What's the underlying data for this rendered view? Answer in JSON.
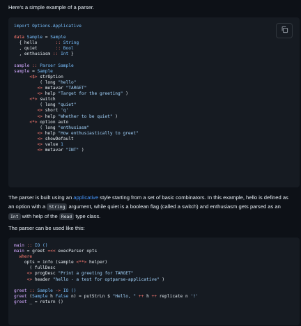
{
  "intro": {
    "text": "Here's a simple example of a parser."
  },
  "code1": {
    "copy_icon": "copy-icon",
    "lines": [
      [
        {
          "t": "import Options.Applicative",
          "c": "ty"
        }
      ],
      [
        {
          "t": "",
          "c": ""
        }
      ],
      [
        {
          "t": "data ",
          "c": "kw"
        },
        {
          "t": "Sample",
          "c": "ty"
        },
        {
          "t": " = ",
          "c": ""
        },
        {
          "t": "Sample",
          "c": "ty"
        }
      ],
      [
        {
          "t": "  { hello       ",
          "c": ""
        },
        {
          "t": ":: ",
          "c": "op"
        },
        {
          "t": "String",
          "c": "ty"
        }
      ],
      [
        {
          "t": "  , quiet       ",
          "c": ""
        },
        {
          "t": ":: ",
          "c": "op"
        },
        {
          "t": "Bool",
          "c": "ty"
        }
      ],
      [
        {
          "t": "  , enthusiasm ",
          "c": ""
        },
        {
          "t": ":: ",
          "c": "op"
        },
        {
          "t": "Int",
          "c": "ty"
        },
        {
          "t": " }",
          "c": ""
        }
      ],
      [
        {
          "t": "",
          "c": ""
        }
      ],
      [
        {
          "t": "sample",
          "c": "fn"
        },
        {
          "t": " :: ",
          "c": "op"
        },
        {
          "t": "Parser Sample",
          "c": "ty"
        }
      ],
      [
        {
          "t": "sample",
          "c": "fn"
        },
        {
          "t": " = ",
          "c": ""
        },
        {
          "t": "Sample",
          "c": "ty"
        }
      ],
      [
        {
          "t": "      ",
          "c": ""
        },
        {
          "t": "<$>",
          "c": "op"
        },
        {
          "t": " strOption",
          "c": ""
        }
      ],
      [
        {
          "t": "          ( long ",
          "c": ""
        },
        {
          "t": "\"hello\"",
          "c": "str"
        }
      ],
      [
        {
          "t": "         ",
          "c": ""
        },
        {
          "t": "<>",
          "c": "op"
        },
        {
          "t": " metavar ",
          "c": ""
        },
        {
          "t": "\"TARGET\"",
          "c": "str"
        }
      ],
      [
        {
          "t": "         ",
          "c": ""
        },
        {
          "t": "<>",
          "c": "op"
        },
        {
          "t": " help ",
          "c": ""
        },
        {
          "t": "\"Target for the greeting\"",
          "c": "str"
        },
        {
          "t": " )",
          "c": ""
        }
      ],
      [
        {
          "t": "      ",
          "c": ""
        },
        {
          "t": "<*>",
          "c": "op"
        },
        {
          "t": " switch",
          "c": ""
        }
      ],
      [
        {
          "t": "          ( long ",
          "c": ""
        },
        {
          "t": "\"quiet\"",
          "c": "str"
        }
      ],
      [
        {
          "t": "         ",
          "c": ""
        },
        {
          "t": "<>",
          "c": "op"
        },
        {
          "t": " short ",
          "c": ""
        },
        {
          "t": "'q'",
          "c": "str"
        }
      ],
      [
        {
          "t": "         ",
          "c": ""
        },
        {
          "t": "<>",
          "c": "op"
        },
        {
          "t": " help ",
          "c": ""
        },
        {
          "t": "\"Whether to be quiet\"",
          "c": "str"
        },
        {
          "t": " )",
          "c": ""
        }
      ],
      [
        {
          "t": "      ",
          "c": ""
        },
        {
          "t": "<*>",
          "c": "op"
        },
        {
          "t": " option auto",
          "c": ""
        }
      ],
      [
        {
          "t": "          ( long ",
          "c": ""
        },
        {
          "t": "\"enthusiasm\"",
          "c": "str"
        }
      ],
      [
        {
          "t": "         ",
          "c": ""
        },
        {
          "t": "<>",
          "c": "op"
        },
        {
          "t": " help ",
          "c": ""
        },
        {
          "t": "\"How enthusiastically to greet\"",
          "c": "str"
        }
      ],
      [
        {
          "t": "         ",
          "c": ""
        },
        {
          "t": "<>",
          "c": "op"
        },
        {
          "t": " showDefault",
          "c": ""
        }
      ],
      [
        {
          "t": "         ",
          "c": ""
        },
        {
          "t": "<>",
          "c": "op"
        },
        {
          "t": " value ",
          "c": ""
        },
        {
          "t": "1",
          "c": "ty"
        }
      ],
      [
        {
          "t": "         ",
          "c": ""
        },
        {
          "t": "<>",
          "c": "op"
        },
        {
          "t": " metavar ",
          "c": ""
        },
        {
          "t": "\"INT\"",
          "c": "str"
        },
        {
          "t": " )",
          "c": ""
        }
      ]
    ]
  },
  "para2": {
    "t1": "The parser is built using an ",
    "link": "applicative",
    "t2": " style starting from a set of basic combinators. In this example, hello is defined as an option with a ",
    "code_a": "String",
    "t3": " argument, while quiet is a boolean flag (called a switch) and enthusiasm gets parsed as an ",
    "code_b": "Int",
    "t4": " with help of the ",
    "code_c": "Read",
    "t5": " type class."
  },
  "para3": {
    "text": "The parser can be used like this:"
  },
  "code2": {
    "lines": [
      [
        {
          "t": "main",
          "c": "fn"
        },
        {
          "t": " :: ",
          "c": "op"
        },
        {
          "t": "IO ()",
          "c": "ty"
        }
      ],
      [
        {
          "t": "main",
          "c": "fn"
        },
        {
          "t": " = greet ",
          "c": ""
        },
        {
          "t": "=<<",
          "c": "op"
        },
        {
          "t": " execParser opts",
          "c": ""
        }
      ],
      [
        {
          "t": "  ",
          "c": ""
        },
        {
          "t": "where",
          "c": "kw"
        }
      ],
      [
        {
          "t": "    opts = info (sample ",
          "c": ""
        },
        {
          "t": "<**>",
          "c": "op"
        },
        {
          "t": " helper)",
          "c": ""
        }
      ],
      [
        {
          "t": "      ( fullDesc",
          "c": ""
        }
      ],
      [
        {
          "t": "     ",
          "c": ""
        },
        {
          "t": "<>",
          "c": "op"
        },
        {
          "t": " progDesc ",
          "c": ""
        },
        {
          "t": "\"Print a greeting for TARGET\"",
          "c": "str"
        }
      ],
      [
        {
          "t": "     ",
          "c": ""
        },
        {
          "t": "<>",
          "c": "op"
        },
        {
          "t": " header ",
          "c": ""
        },
        {
          "t": "\"hello - a test for optparse-applicative\"",
          "c": "str"
        },
        {
          "t": " )",
          "c": ""
        }
      ],
      [
        {
          "t": "",
          "c": ""
        }
      ],
      [
        {
          "t": "greet",
          "c": "fn"
        },
        {
          "t": " :: ",
          "c": "op"
        },
        {
          "t": "Sample",
          "c": "ty"
        },
        {
          "t": " -> ",
          "c": "op"
        },
        {
          "t": "IO ()",
          "c": "ty"
        }
      ],
      [
        {
          "t": "greet",
          "c": "fn"
        },
        {
          "t": " (",
          "c": ""
        },
        {
          "t": "Sample",
          "c": "ty"
        },
        {
          "t": " h ",
          "c": ""
        },
        {
          "t": "False",
          "c": "ty"
        },
        {
          "t": " n) = putStrLn $ ",
          "c": ""
        },
        {
          "t": "\"Hello, \"",
          "c": "str"
        },
        {
          "t": " ++ ",
          "c": "op"
        },
        {
          "t": "h",
          "c": ""
        },
        {
          "t": " ++ ",
          "c": "op"
        },
        {
          "t": "replicate n ",
          "c": ""
        },
        {
          "t": "'!'",
          "c": "str"
        }
      ],
      [
        {
          "t": "greet",
          "c": "fn"
        },
        {
          "t": " _ = return ()",
          "c": ""
        }
      ]
    ]
  }
}
